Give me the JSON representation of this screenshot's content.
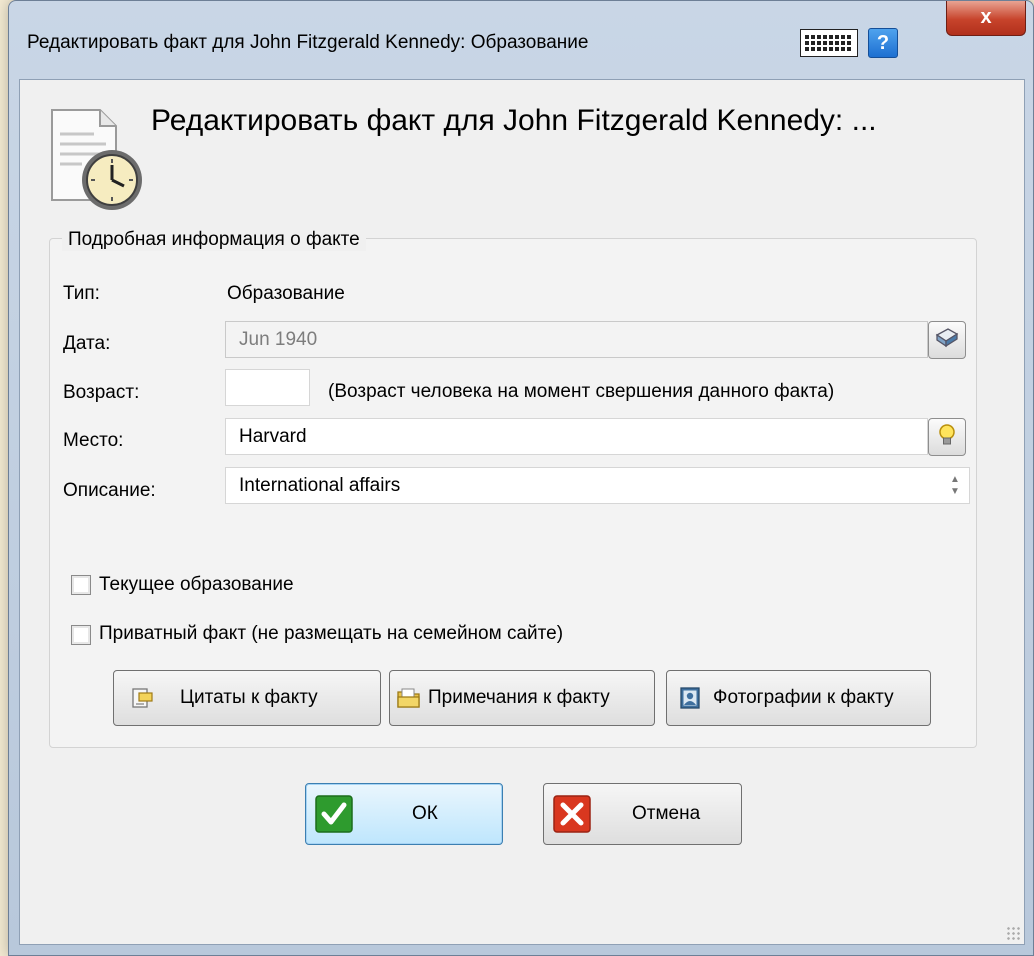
{
  "window": {
    "title": "Редактировать факт для John Fitzgerald Kennedy: Образование",
    "help_glyph": "?",
    "close_glyph": "x"
  },
  "header": {
    "title": "Редактировать факт для John Fitzgerald Kennedy: ..."
  },
  "details": {
    "legend": "Подробная информация о факте",
    "type_label": "Тип:",
    "type_value": "Образование",
    "date_label": "Дата:",
    "date_value": "Jun 1940",
    "age_label": "Возраст:",
    "age_value": "",
    "age_hint": "(Возраст человека на момент свершения данного факта)",
    "place_label": "Место:",
    "place_value": "Harvard",
    "description_label": "Описание:",
    "description_value": "International affairs"
  },
  "checkboxes": {
    "current_label": "Текущее образование",
    "current_checked": false,
    "private_label": "Приватный факт (не размещать на семейном сайте)",
    "private_checked": false
  },
  "fact_buttons": {
    "quotes_label": "Цитаты к факту",
    "notes_label": "Примечания к факту",
    "photos_label": "Фотографии к факту"
  },
  "dialog_buttons": {
    "ok_label": "ОК",
    "cancel_label": "Отмена"
  },
  "icons": {
    "header": "document-clock-icon",
    "date_picker": "calendar-icon",
    "place_lookup": "lightbulb-icon",
    "quotes": "quote-note-icon",
    "notes": "folder-notes-icon",
    "photos": "photo-icon",
    "ok": "checkmark-icon",
    "cancel": "cross-icon"
  },
  "colors": {
    "ok_green": "#2e9b2e",
    "cancel_red": "#d9371f",
    "close_red": "#c7432b",
    "help_blue": "#1d6fd1"
  }
}
